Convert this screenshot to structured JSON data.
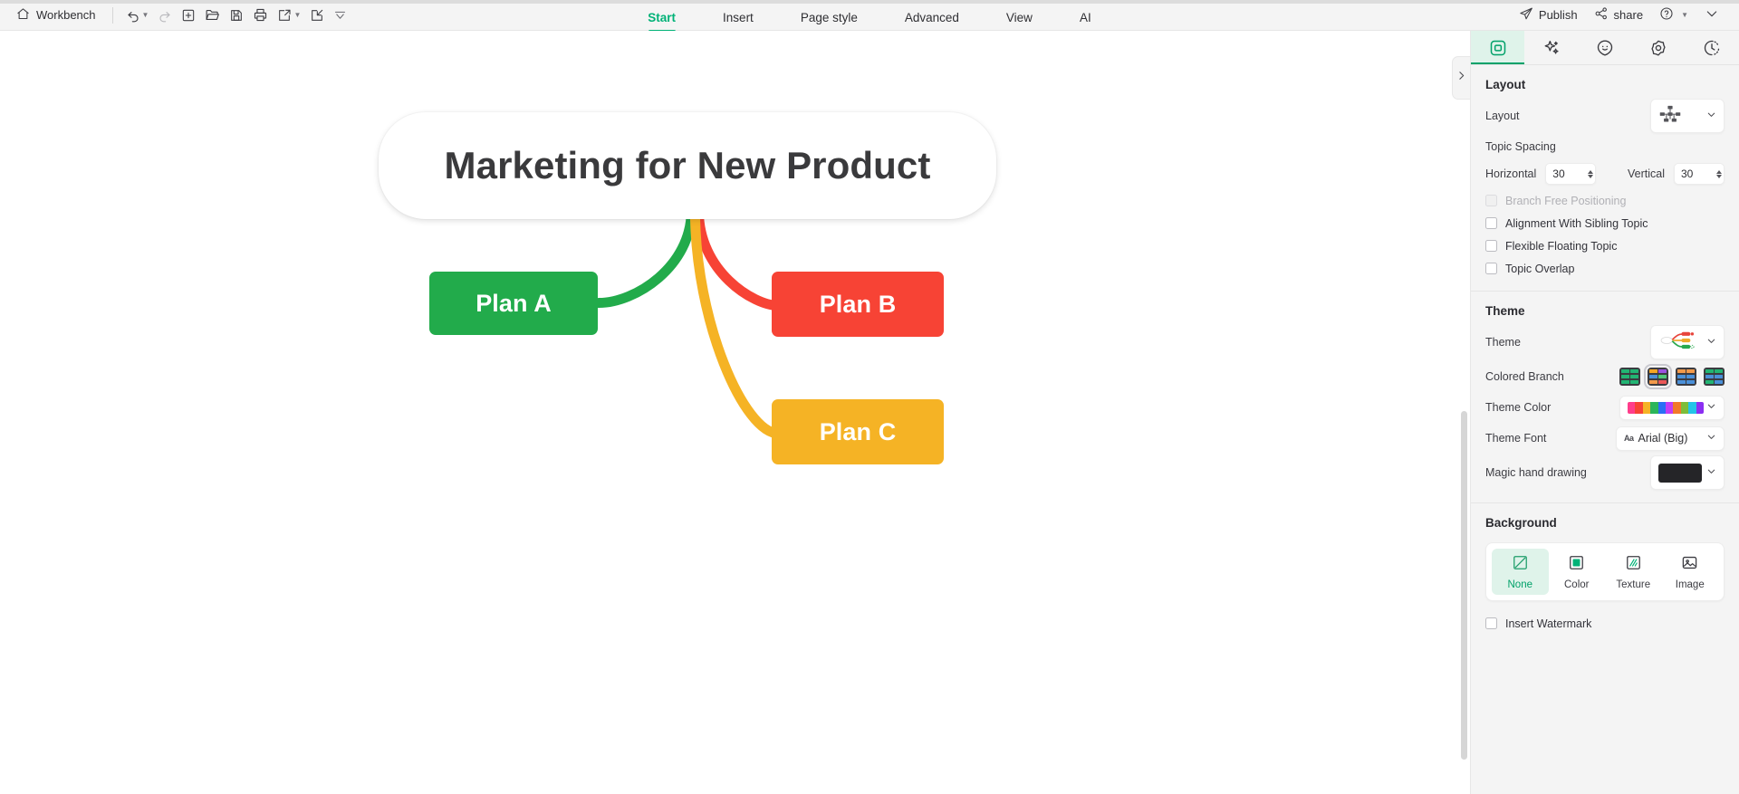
{
  "menubar": {
    "workbench": "Workbench",
    "tools": [
      {
        "name": "undo-button",
        "icon": "undo-icon",
        "caret": true,
        "disabled": false
      },
      {
        "name": "redo-button",
        "icon": "redo-icon",
        "caret": false,
        "disabled": true
      },
      {
        "name": "new-button",
        "icon": "plus-square-icon",
        "caret": false,
        "disabled": false
      },
      {
        "name": "open-button",
        "icon": "folder-icon",
        "caret": false,
        "disabled": false
      },
      {
        "name": "save-button",
        "icon": "floppy-disk-icon",
        "caret": false,
        "disabled": false
      },
      {
        "name": "print-button",
        "icon": "printer-icon",
        "caret": false,
        "disabled": false
      },
      {
        "name": "export-button",
        "icon": "export-icon",
        "caret": true,
        "disabled": false
      },
      {
        "name": "import-button",
        "icon": "import-icon",
        "caret": false,
        "disabled": false
      },
      {
        "name": "more-tools-button",
        "icon": "chevron-down-icon",
        "caret": false,
        "disabled": false
      }
    ],
    "tabs": [
      {
        "label": "Start",
        "active": true
      },
      {
        "label": "Insert",
        "active": false
      },
      {
        "label": "Page style",
        "active": false
      },
      {
        "label": "Advanced",
        "active": false
      },
      {
        "label": "View",
        "active": false
      },
      {
        "label": "AI",
        "active": false
      }
    ],
    "publish": "Publish",
    "share": "share",
    "help_icon": "help-circle-icon",
    "collapse_icon": "chevron-down-icon",
    "accent": "#00b277"
  },
  "canvas": {
    "toggle_icon": "chevron-right-icon",
    "mindmap": {
      "root": {
        "text": "Marketing for New Product",
        "fill": "#ffffff",
        "text_color": "#3a3a3c"
      },
      "children": [
        {
          "text": "Plan A",
          "fill": "#22ab4b",
          "branch_color": "#22ab4b"
        },
        {
          "text": "Plan B",
          "fill": "#f74335",
          "branch_color": "#f74335"
        },
        {
          "text": "Plan C",
          "fill": "#f5b325",
          "branch_color": "#f5b325"
        }
      ]
    }
  },
  "panel": {
    "tabs": [
      {
        "name": "style-tab",
        "icon": "square-in-square-icon",
        "active": true
      },
      {
        "name": "ai-tab",
        "icon": "sparkles-icon",
        "active": false
      },
      {
        "name": "emoji-tab",
        "icon": "smiley-icon",
        "active": false
      },
      {
        "name": "sticker-tab",
        "icon": "flower-gear-icon",
        "active": false
      },
      {
        "name": "history-tab",
        "icon": "clock-dotted-icon",
        "active": false
      }
    ],
    "layout": {
      "section_title": "Layout",
      "layout_label": "Layout",
      "layout_value_icon": "org-chart-icon",
      "topic_spacing_label": "Topic Spacing",
      "horizontal_label": "Horizontal",
      "horizontal_value": "30",
      "vertical_label": "Vertical",
      "vertical_value": "30",
      "checkboxes": [
        {
          "label": "Branch Free Positioning",
          "checked": false,
          "disabled": true
        },
        {
          "label": "Alignment With Sibling Topic",
          "checked": false,
          "disabled": false
        },
        {
          "label": "Flexible Floating Topic",
          "checked": false,
          "disabled": false
        },
        {
          "label": "Topic Overlap",
          "checked": false,
          "disabled": false
        }
      ]
    },
    "theme": {
      "section_title": "Theme",
      "theme_label": "Theme",
      "theme_preview_icon": "mindmap-thumbnail-icon",
      "colored_branch_label": "Colored Branch",
      "colored_branch_options": [
        {
          "name": "colored-branch-green",
          "selected": false,
          "colors": [
            "#22b573",
            "#22b573",
            "#22b573",
            "#22b573",
            "#22b573",
            "#22b573"
          ]
        },
        {
          "name": "colored-branch-multi",
          "selected": true,
          "colors": [
            "#f5a623",
            "#9b51e0",
            "#4a90d9",
            "#50c878",
            "#f2994a",
            "#eb5757"
          ]
        },
        {
          "name": "colored-branch-orange-blue",
          "selected": false,
          "colors": [
            "#f2994a",
            "#f2994a",
            "#4a90d9",
            "#4a90d9",
            "#4a90d9",
            "#4a90d9"
          ]
        },
        {
          "name": "colored-branch-teal-blue",
          "selected": false,
          "colors": [
            "#22b573",
            "#22b573",
            "#4a90d9",
            "#4a90d9",
            "#22b573",
            "#4a90d9"
          ]
        }
      ],
      "theme_color_label": "Theme Color",
      "theme_color_swatches": [
        "#ff3d8b",
        "#f74335",
        "#f5b325",
        "#2bb55a",
        "#2a6ff5",
        "#c23cf5",
        "#f2782a",
        "#7dbd3a",
        "#23c4e8",
        "#8b2ef2"
      ],
      "theme_font_label": "Theme Font",
      "theme_font_value": "Arial (Big)",
      "theme_font_icon": "aa-icon",
      "magic_hand_label": "Magic hand drawing",
      "magic_hand_color": "#252528"
    },
    "background": {
      "section_title": "Background",
      "options": [
        {
          "label": "None",
          "icon": "none-slash-icon",
          "selected": true
        },
        {
          "label": "Color",
          "icon": "filled-square-icon",
          "selected": false
        },
        {
          "label": "Texture",
          "icon": "hatch-square-icon",
          "selected": false
        },
        {
          "label": "Image",
          "icon": "picture-icon",
          "selected": false
        }
      ],
      "watermark_label": "Insert Watermark",
      "watermark_checked": false
    }
  }
}
